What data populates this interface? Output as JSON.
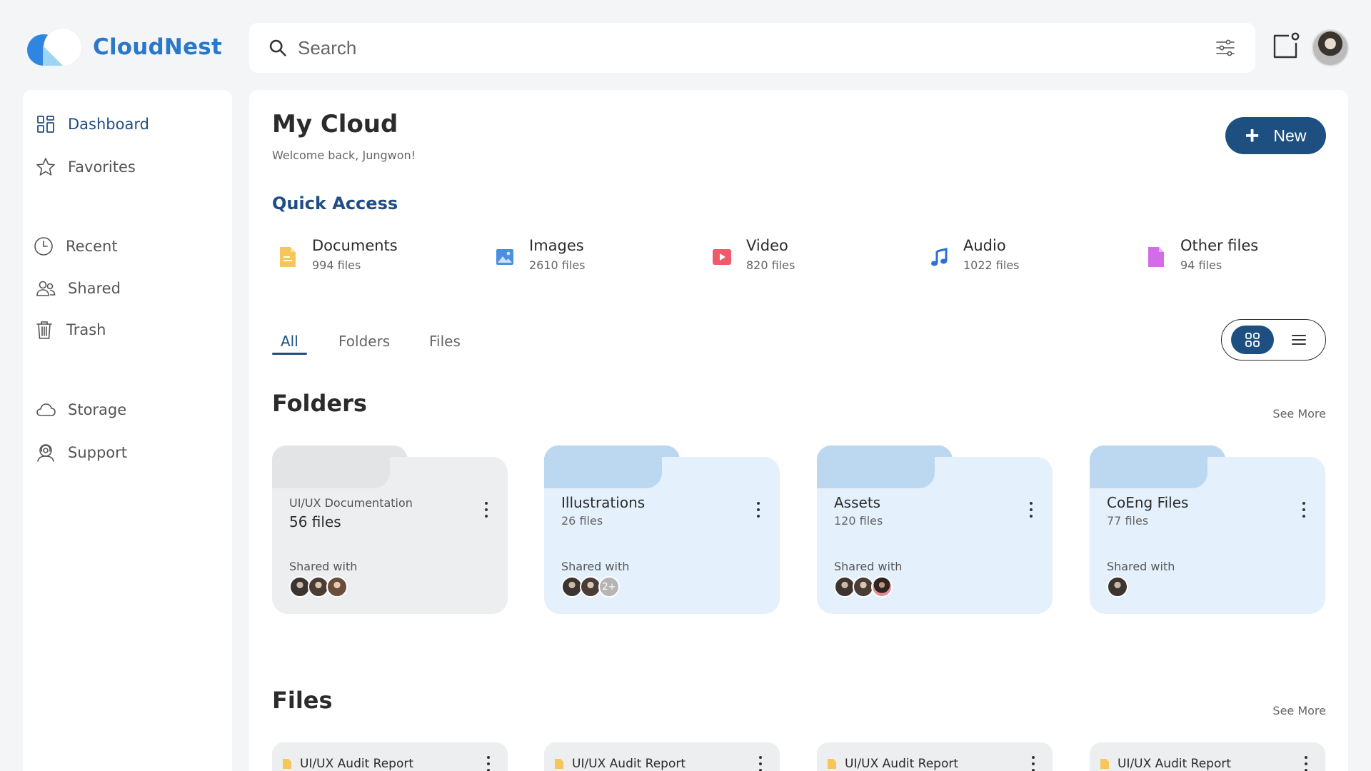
{
  "app": {
    "name": "CloudNest"
  },
  "search": {
    "placeholder": "Search"
  },
  "sidebar": {
    "items": [
      {
        "label": "Dashboard",
        "icon": "dashboard-icon",
        "active": true
      },
      {
        "label": "Favorites",
        "icon": "star-icon"
      },
      {
        "label": "Recent",
        "icon": "clock-icon"
      },
      {
        "label": "Shared",
        "icon": "users-icon"
      },
      {
        "label": "Trash",
        "icon": "trash-icon"
      },
      {
        "label": "Storage",
        "icon": "cloud-icon"
      },
      {
        "label": "Support",
        "icon": "support-icon"
      }
    ]
  },
  "main": {
    "title": "My Cloud",
    "welcome": "Welcome back, Jungwon!",
    "new_button": "New",
    "quick_access": {
      "title": "Quick Access",
      "items": [
        {
          "name": "Documents",
          "count": "994 files",
          "icon": "document-icon",
          "color": "#f7c65a"
        },
        {
          "name": "Images",
          "count": "2610 files",
          "icon": "image-icon",
          "color": "#4a8fe0"
        },
        {
          "name": "Video",
          "count": "820 files",
          "icon": "video-icon",
          "color": "#ef5b6a"
        },
        {
          "name": "Audio",
          "count": "1022 files",
          "icon": "music-icon",
          "color": "#2f6fd6"
        },
        {
          "name": "Other files",
          "count": "94 files",
          "icon": "file-icon",
          "color": "#d46be8"
        }
      ]
    },
    "tabs": [
      "All",
      "Folders",
      "Files"
    ],
    "folders": {
      "title": "Folders",
      "see_more": "See More",
      "shared_label": "Shared with",
      "items": [
        {
          "name": "UI/UX Documentation",
          "count": "56 files",
          "theme": "gray"
        },
        {
          "name": "Illustrations",
          "count": "26 files",
          "theme": "blue",
          "extra": "2+"
        },
        {
          "name": "Assets",
          "count": "120 files",
          "theme": "blue"
        },
        {
          "name": "CoEng Files",
          "count": "77 files",
          "theme": "blue"
        }
      ]
    },
    "files": {
      "title": "Files",
      "see_more": "See More",
      "items": [
        {
          "name": "UI/UX Audit Report"
        },
        {
          "name": "UI/UX Audit Report"
        },
        {
          "name": "UI/UX Audit Report"
        },
        {
          "name": "UI/UX Audit Report"
        }
      ]
    }
  },
  "colors": {
    "accent": "#1d4f80",
    "brand": "#2a78c9"
  }
}
